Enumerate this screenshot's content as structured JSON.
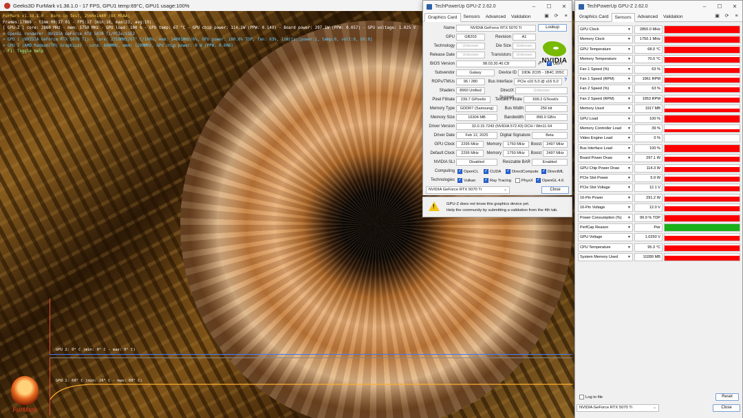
{
  "furmark": {
    "title": "Geeks3D FurMark v1.38.1.0 - 17 FPS, GPU1 temp:69°C, GPU1 usage:100%",
    "osd": [
      "FurMark v1.38.1.0 - Burn-in test, 2560x1440 (8X MSAA)",
      "Frames:17966 - time:00:17:01 - FPS:17 (min:16, max:23, avg:19)",
      "[ GPU-Z ] core: 2860 MHz - mem: 1750 MHz - GPU load: 100 % - GPU temp: 67 °C - GPU chip power: 114.1W (PPW: 0.149) - Board power: 297.1W (PPW: 0.057) - GPU voltage: 1.025 V",
      "> OpenGL renderer: NVIDIA GeForce RTX 5070 Ti/PCIe/SSE2",
      "> GPU 1 (NVIDIA GeForce RTX 5070 Ti) - core: 2350MHz/67° C/100%, mem: 14001MHz/6%, GPU power: 100.0% TDP, fan: 63%, limits:[power:1, temp:0, volt:0, OV:0]",
      "> GPU 2 (AMD Radeon(TM) Graphics) - core: 600MHz, mem: 1200MHz, GPU chip power: 0 W (PPW: 0.006)",
      "- F1: Toggle help"
    ],
    "graph1_label": "GPU 2: 0° C (min: 0° C - max: 0° C)",
    "graph2_label": "GPU 1: 68° C (min: 26° C - max: 68° C)",
    "logo_text": "FurMark"
  },
  "gpuz_main": {
    "title": "TechPowerUp GPU-Z 2.62.0",
    "tabs": [
      "Graphics Card",
      "Sensors",
      "Advanced",
      "Validation"
    ],
    "labels": {
      "name": "Name",
      "gpu": "GPU",
      "revision": "Revision",
      "technology": "Technology",
      "die_size": "Die Size",
      "release_date": "Release Date",
      "transistors": "Transistors",
      "bios_version": "BIOS Version",
      "subvendor": "Subvendor",
      "device_id": "Device ID",
      "rops_tmus": "ROPs/TMUs",
      "bus_interface": "Bus Interface",
      "shaders": "Shaders",
      "directx": "DirectX Support",
      "pixel_fillrate": "Pixel Fillrate",
      "texture_fillrate": "Texture Fillrate",
      "memory_type": "Memory Type",
      "bus_width": "Bus Width",
      "memory_size": "Memory Size",
      "bandwidth": "Bandwidth",
      "driver_version": "Driver Version",
      "driver_date": "Driver Date",
      "digital_signature": "Digital Signature",
      "gpu_clock": "GPU Clock",
      "memory": "Memory",
      "boost": "Boost",
      "default_clock": "Default Clock",
      "nvidia_sli": "NVIDIA SLI",
      "resizable_bar": "Resizable BAR",
      "computing": "Computing",
      "technologies": "Technologies"
    },
    "values": {
      "name": "NVIDIA GeForce RTX 5070 Ti",
      "gpu": "GB203",
      "revision": "A1",
      "technology": "Unknown",
      "die_size": "Unknown",
      "release_date": "Unknown",
      "transistors": "Unknown",
      "bios_version": "98.03.30.40.C8",
      "subvendor": "Galaxy",
      "device_id": "10DE 2C05 - 1B4C 205C",
      "rops_tmus": "96 / 280",
      "bus_interface": "PCIe x16 5.0 @ x16 5.0",
      "shaders": "8960 Unified",
      "directx": "Unknown",
      "pixel_fillrate": "239.7 GPixel/s",
      "texture_fillrate": "699.2 GTexel/s",
      "memory_type": "GDDR7 (Samsung)",
      "bus_width": "256 bit",
      "memory_size": "16304 MB",
      "bandwidth": "896.0 GB/s",
      "driver_version": "32.0.15.7243 (NVIDIA 572.43) DCH / Win11 64",
      "driver_date": "Feb 12, 2025",
      "digital_signature": "Beta",
      "gpu_clock": "2295 MHz",
      "gpu_memory": "1750 MHz",
      "gpu_boost": "2497 MHz",
      "default_clock": "2295 MHz",
      "default_memory": "1750 MHz",
      "default_boost": "2497 MHz",
      "nvidia_sli": "Disabled",
      "resizable_bar": "Enabled"
    },
    "lookup_button": "Lookup",
    "uefi_label": "UEFI",
    "computing": [
      "OpenCL",
      "CUDA",
      "DirectCompute",
      "DirectML"
    ],
    "technologies": [
      {
        "label": "Vulkan",
        "checked": true
      },
      {
        "label": "Ray Tracing",
        "checked": true
      },
      {
        "label": "PhysX",
        "checked": false
      },
      {
        "label": "OpenGL 4.6",
        "checked": true
      }
    ],
    "selected_device": "NVIDIA GeForce RTX 5070 Ti",
    "close_button": "Close"
  },
  "notice": {
    "line1": "GPU-Z does not know this graphics device yet.",
    "line2": "Help the community by submitting a validation from the 4th tab."
  },
  "gpuz_sensors": {
    "title": "TechPowerUp GPU-Z 2.62.0",
    "tabs": [
      "Graphics Card",
      "Sensors",
      "Advanced",
      "Validation"
    ],
    "sensors": [
      {
        "name": "GPU Clock",
        "value": "2850.0 MHz",
        "level": 0.97,
        "color": "#ff0000"
      },
      {
        "name": "Memory Clock",
        "value": "1750.1 MHz",
        "level": 0.97,
        "color": "#ff0000"
      },
      {
        "name": "GPU Temperature",
        "value": "68.0 °C",
        "level": 0.85,
        "color": "#ff0000"
      },
      {
        "name": "Memory Temperature",
        "value": "70.0 °C",
        "level": 0.85,
        "color": "#ff0000"
      },
      {
        "name": "Fan 1 Speed (%)",
        "value": "63 %",
        "level": 0.7,
        "color": "#ff0000"
      },
      {
        "name": "Fan 1 Speed (RPM)",
        "value": "1961 RPM",
        "level": 0.7,
        "color": "#ff0000"
      },
      {
        "name": "Fan 2 Speed (%)",
        "value": "63 %",
        "level": 0.7,
        "color": "#ff0000"
      },
      {
        "name": "Fan 2 Speed (RPM)",
        "value": "1953 RPM",
        "level": 0.7,
        "color": "#ff0000"
      },
      {
        "name": "Memory Used",
        "value": "1917 MB",
        "level": 0.5,
        "color": "#ff0000"
      },
      {
        "name": "GPU Load",
        "value": "100 %",
        "level": 1.0,
        "color": "#ff0000"
      },
      {
        "name": "Memory Controller Load",
        "value": "39 %",
        "level": 0.4,
        "color": "#ff0000"
      },
      {
        "name": "Video Engine Load",
        "value": "0 %",
        "level": 0.0,
        "color": "#ff0000"
      },
      {
        "name": "Bus Interface Load",
        "value": "100 %",
        "level": 1.0,
        "color": "#ff0000"
      },
      {
        "name": "Board Power Draw",
        "value": "297.1 W",
        "level": 0.7,
        "color": "#ff0000"
      },
      {
        "name": "GPU Chip Power Draw",
        "value": "114.3 W",
        "level": 0.7,
        "color": "#ff0000"
      },
      {
        "name": "PCIe Slot Power",
        "value": "5.9 W",
        "level": 0.7,
        "color": "#ff0000"
      },
      {
        "name": "PCIe Slot Voltage",
        "value": "12.1 V",
        "level": 0.7,
        "color": "#ff0000"
      },
      {
        "name": "16-Pin Power",
        "value": "291.2 W",
        "level": 0.7,
        "color": "#ff0000"
      },
      {
        "name": "16-Pin Voltage",
        "value": "12.0 V",
        "level": 0.7,
        "color": "#ff0000"
      },
      {
        "name": "Power Consumption (%)",
        "value": "99.9 % TDP",
        "level": 0.85,
        "color": "#ff0000"
      },
      {
        "name": "PerfCap Reason",
        "value": "Pwr",
        "level": 1.0,
        "color": "#19b019"
      },
      {
        "name": "GPU Voltage",
        "value": "1.0250 V",
        "level": 0.7,
        "color": "#ff0000"
      },
      {
        "name": "CPU Temperature",
        "value": "95.3 °C",
        "level": 0.75,
        "color": "#ff0000"
      },
      {
        "name": "System Memory Used",
        "value": "10289 MB",
        "level": 0.7,
        "color": "#ff0000"
      }
    ],
    "log_label": "Log to file",
    "reset_button": "Reset",
    "selected_device": "NVIDIA GeForce RTX 5070 Ti",
    "close_button": "Close"
  }
}
